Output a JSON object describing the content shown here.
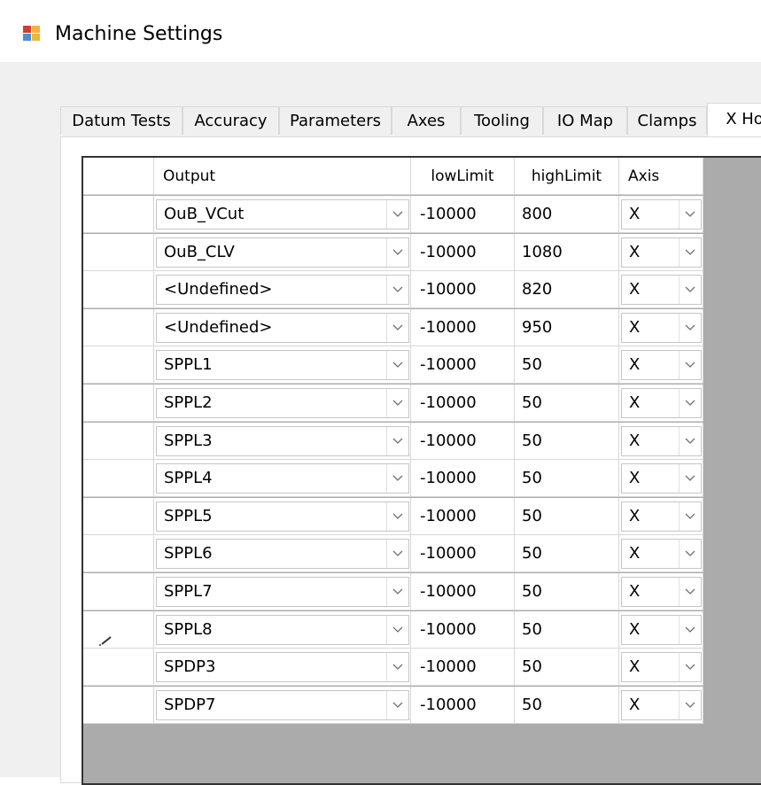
{
  "window": {
    "title": "Machine Settings"
  },
  "tabs": [
    {
      "label": "Datum Tests",
      "selected": false
    },
    {
      "label": "Accuracy",
      "selected": false
    },
    {
      "label": "Parameters",
      "selected": false
    },
    {
      "label": "Axes",
      "selected": false
    },
    {
      "label": "Tooling",
      "selected": false
    },
    {
      "label": "IO Map",
      "selected": false
    },
    {
      "label": "Clamps",
      "selected": false
    },
    {
      "label": "X Hol",
      "selected": true
    }
  ],
  "grid": {
    "columns": [
      "Output",
      "lowLimit",
      "highLimit",
      "Axis"
    ],
    "rows": [
      {
        "output": "OuB_VCut",
        "low": "-10000",
        "high": "800",
        "axis": "X",
        "editing": false
      },
      {
        "output": "OuB_CLV",
        "low": "-10000",
        "high": "1080",
        "axis": "X",
        "editing": false
      },
      {
        "output": "<Undefined>",
        "low": "-10000",
        "high": "820",
        "axis": "X",
        "editing": false
      },
      {
        "output": "<Undefined>",
        "low": "-10000",
        "high": "950",
        "axis": "X",
        "editing": false
      },
      {
        "output": "SPPL1",
        "low": "-10000",
        "high": "50",
        "axis": "X",
        "editing": false
      },
      {
        "output": "SPPL2",
        "low": "-10000",
        "high": "50",
        "axis": "X",
        "editing": false
      },
      {
        "output": "SPPL3",
        "low": "-10000",
        "high": "50",
        "axis": "X",
        "editing": false
      },
      {
        "output": "SPPL4",
        "low": "-10000",
        "high": "50",
        "axis": "X",
        "editing": false
      },
      {
        "output": "SPPL5",
        "low": "-10000",
        "high": "50",
        "axis": "X",
        "editing": false
      },
      {
        "output": "SPPL6",
        "low": "-10000",
        "high": "50",
        "axis": "X",
        "editing": false
      },
      {
        "output": "SPPL7",
        "low": "-10000",
        "high": "50",
        "axis": "X",
        "editing": false
      },
      {
        "output": "SPPL8",
        "low": "-10000",
        "high": "50",
        "axis": "X",
        "editing": true
      },
      {
        "output": "SPDP3",
        "low": "-10000",
        "high": "50",
        "axis": "X",
        "editing": false
      },
      {
        "output": "SPDP7",
        "low": "-10000",
        "high": "50",
        "axis": "X",
        "editing": false
      }
    ]
  },
  "icons": {
    "app": "app-icon",
    "dropdown": "chevron-down-icon",
    "row_edit": "pencil-icon"
  }
}
